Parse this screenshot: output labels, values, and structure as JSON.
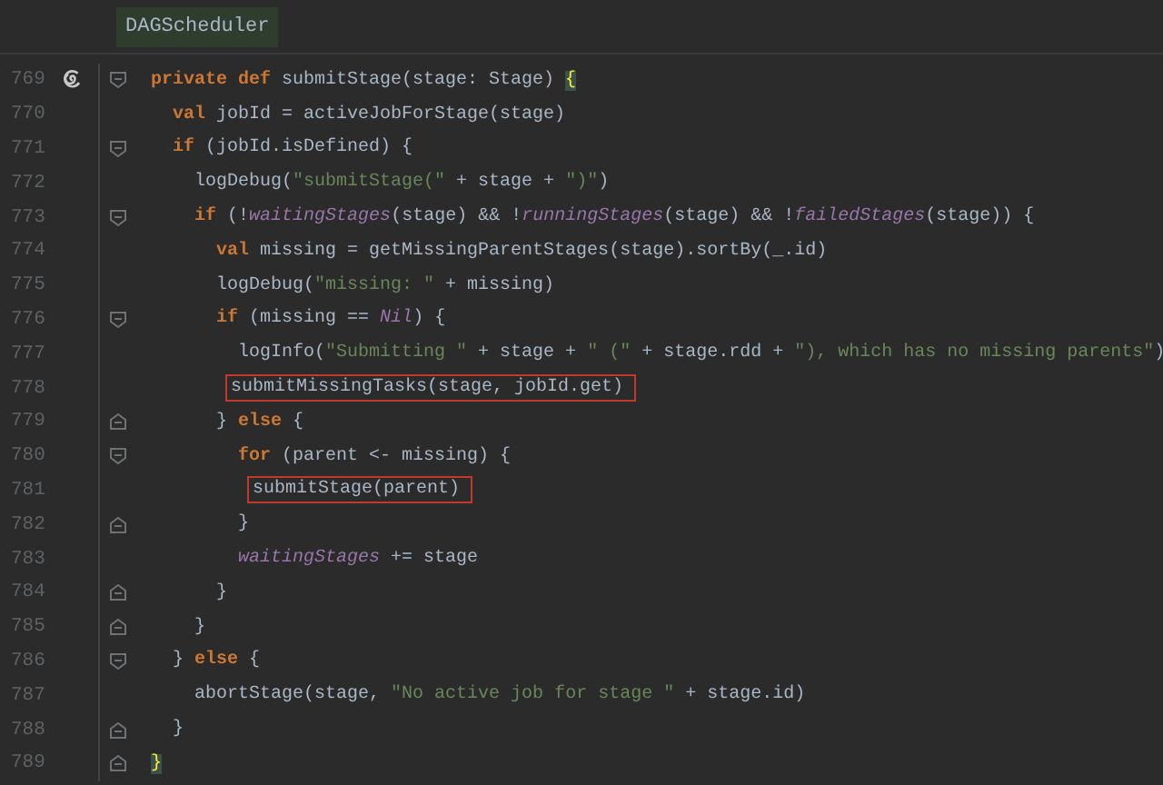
{
  "breadcrumb": {
    "label": "DAGScheduler"
  },
  "lines": [
    {
      "number": "769",
      "recursive": true,
      "fold_start": true,
      "fold_end": false,
      "boxed": false,
      "tokens": [
        {
          "kind": "keyword",
          "text": "private def "
        },
        {
          "kind": "plain",
          "text": "submitStage(stage: Stage) "
        },
        {
          "kind": "match",
          "text": "{"
        }
      ]
    },
    {
      "number": "770",
      "recursive": false,
      "fold_start": false,
      "fold_end": false,
      "boxed": false,
      "tokens": [
        {
          "kind": "keyword",
          "text": "  val "
        },
        {
          "kind": "plain",
          "text": "jobId = activeJobForStage(stage)"
        }
      ]
    },
    {
      "number": "771",
      "recursive": false,
      "fold_start": true,
      "fold_end": false,
      "boxed": false,
      "tokens": [
        {
          "kind": "keyword",
          "text": "  if "
        },
        {
          "kind": "plain",
          "text": "(jobId.isDefined) {"
        }
      ]
    },
    {
      "number": "772",
      "recursive": false,
      "fold_start": false,
      "fold_end": false,
      "boxed": false,
      "tokens": [
        {
          "kind": "plain",
          "text": "    logDebug("
        },
        {
          "kind": "string",
          "text": "\"submitStage(\""
        },
        {
          "kind": "plain",
          "text": " + stage + "
        },
        {
          "kind": "string",
          "text": "\")\""
        },
        {
          "kind": "plain",
          "text": ")"
        }
      ]
    },
    {
      "number": "773",
      "recursive": false,
      "fold_start": true,
      "fold_end": false,
      "boxed": false,
      "tokens": [
        {
          "kind": "keyword",
          "text": "    if "
        },
        {
          "kind": "plain",
          "text": "(!"
        },
        {
          "kind": "field",
          "text": "waitingStages"
        },
        {
          "kind": "plain",
          "text": "(stage) && !"
        },
        {
          "kind": "field",
          "text": "runningStages"
        },
        {
          "kind": "plain",
          "text": "(stage) && !"
        },
        {
          "kind": "field",
          "text": "failedStages"
        },
        {
          "kind": "plain",
          "text": "(stage)) {"
        }
      ]
    },
    {
      "number": "774",
      "recursive": false,
      "fold_start": false,
      "fold_end": false,
      "boxed": false,
      "tokens": [
        {
          "kind": "keyword",
          "text": "      val "
        },
        {
          "kind": "plain",
          "text": "missing = getMissingParentStages(stage).sortBy(_.id)"
        }
      ]
    },
    {
      "number": "775",
      "recursive": false,
      "fold_start": false,
      "fold_end": false,
      "boxed": false,
      "tokens": [
        {
          "kind": "plain",
          "text": "      logDebug("
        },
        {
          "kind": "string",
          "text": "\"missing: \""
        },
        {
          "kind": "plain",
          "text": " + missing)"
        }
      ]
    },
    {
      "number": "776",
      "recursive": false,
      "fold_start": true,
      "fold_end": false,
      "boxed": false,
      "tokens": [
        {
          "kind": "keyword",
          "text": "      if "
        },
        {
          "kind": "plain",
          "text": "(missing == "
        },
        {
          "kind": "field",
          "text": "Nil"
        },
        {
          "kind": "plain",
          "text": ") {"
        }
      ]
    },
    {
      "number": "777",
      "recursive": false,
      "fold_start": false,
      "fold_end": false,
      "boxed": false,
      "tokens": [
        {
          "kind": "plain",
          "text": "        logInfo("
        },
        {
          "kind": "string",
          "text": "\"Submitting \""
        },
        {
          "kind": "plain",
          "text": " + stage + "
        },
        {
          "kind": "string",
          "text": "\" (\""
        },
        {
          "kind": "plain",
          "text": " + stage.rdd + "
        },
        {
          "kind": "string",
          "text": "\"), which has no missing parents\""
        },
        {
          "kind": "plain",
          "text": ")"
        }
      ]
    },
    {
      "number": "778",
      "recursive": false,
      "fold_start": false,
      "fold_end": false,
      "boxed": true,
      "tokens": [
        {
          "kind": "plain",
          "text": "        submitMissingTasks(stage, jobId.get)"
        }
      ]
    },
    {
      "number": "779",
      "recursive": false,
      "fold_start": false,
      "fold_end": true,
      "boxed": false,
      "tokens": [
        {
          "kind": "plain",
          "text": "      } "
        },
        {
          "kind": "keyword",
          "text": "else "
        },
        {
          "kind": "plain",
          "text": "{"
        }
      ]
    },
    {
      "number": "780",
      "recursive": false,
      "fold_start": true,
      "fold_end": false,
      "boxed": false,
      "tokens": [
        {
          "kind": "keyword",
          "text": "        for "
        },
        {
          "kind": "plain",
          "text": "(parent <- missing) {"
        }
      ]
    },
    {
      "number": "781",
      "recursive": false,
      "fold_start": false,
      "fold_end": false,
      "boxed": true,
      "tokens": [
        {
          "kind": "plain",
          "text": "          submitStage(parent)"
        }
      ]
    },
    {
      "number": "782",
      "recursive": false,
      "fold_start": false,
      "fold_end": true,
      "boxed": false,
      "tokens": [
        {
          "kind": "plain",
          "text": "        }"
        }
      ]
    },
    {
      "number": "783",
      "recursive": false,
      "fold_start": false,
      "fold_end": false,
      "boxed": false,
      "tokens": [
        {
          "kind": "field",
          "text": "        waitingStages"
        },
        {
          "kind": "plain",
          "text": " += stage"
        }
      ]
    },
    {
      "number": "784",
      "recursive": false,
      "fold_start": false,
      "fold_end": true,
      "boxed": false,
      "tokens": [
        {
          "kind": "plain",
          "text": "      }"
        }
      ]
    },
    {
      "number": "785",
      "recursive": false,
      "fold_start": false,
      "fold_end": true,
      "boxed": false,
      "tokens": [
        {
          "kind": "plain",
          "text": "    }"
        }
      ]
    },
    {
      "number": "786",
      "recursive": false,
      "fold_start": true,
      "fold_end": false,
      "boxed": false,
      "tokens": [
        {
          "kind": "plain",
          "text": "  } "
        },
        {
          "kind": "keyword",
          "text": "else "
        },
        {
          "kind": "plain",
          "text": "{"
        }
      ]
    },
    {
      "number": "787",
      "recursive": false,
      "fold_start": false,
      "fold_end": false,
      "boxed": false,
      "tokens": [
        {
          "kind": "plain",
          "text": "    abortStage(stage, "
        },
        {
          "kind": "string",
          "text": "\"No active job for stage \""
        },
        {
          "kind": "plain",
          "text": " + stage.id)"
        }
      ]
    },
    {
      "number": "788",
      "recursive": false,
      "fold_start": false,
      "fold_end": true,
      "boxed": false,
      "tokens": [
        {
          "kind": "plain",
          "text": "  }"
        }
      ]
    },
    {
      "number": "789",
      "recursive": false,
      "fold_start": false,
      "fold_end": true,
      "boxed": false,
      "tokens": [
        {
          "kind": "match",
          "text": "}"
        }
      ]
    }
  ]
}
